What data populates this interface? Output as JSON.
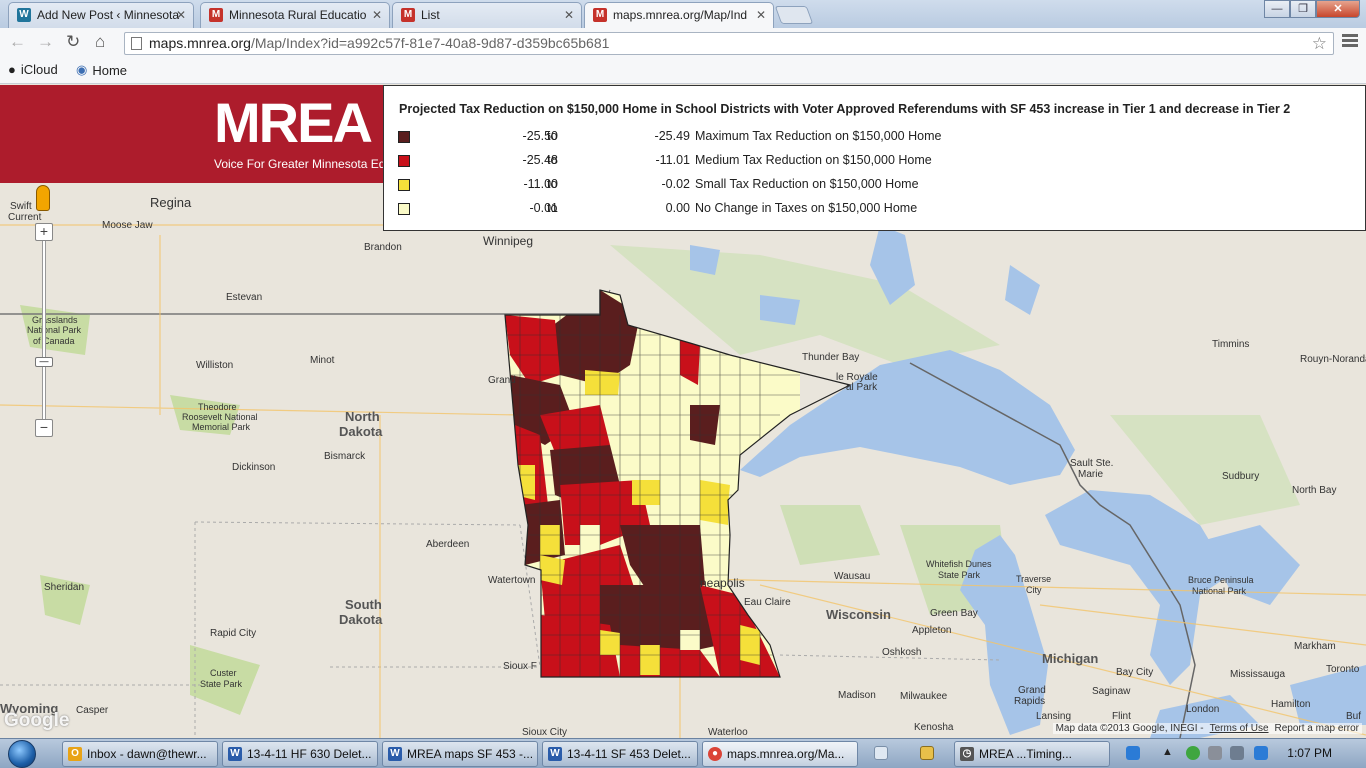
{
  "tabs": [
    {
      "title": "Add New Post ‹ Minnesota",
      "favicon": "wordpress-icon",
      "color": "#21759b",
      "glyph": "W"
    },
    {
      "title": "Minnesota Rural Educatio",
      "favicon": "gmail-icon",
      "color": "#c5322b",
      "glyph": "M"
    },
    {
      "title": "List",
      "favicon": "gmail-icon",
      "color": "#c5322b",
      "glyph": "M"
    },
    {
      "title": "maps.mnrea.org/Map/Ind",
      "favicon": "gmail-icon",
      "color": "#c5322b",
      "glyph": "M"
    }
  ],
  "toolbar": {
    "url_host": "maps.mnrea.org",
    "url_path": "/Map/Index?id=a992c57f-81e7-40a8-9d87-d359bc65b681"
  },
  "bookmarks": [
    {
      "label": "iCloud",
      "icon": "apple-icon"
    },
    {
      "label": "Home",
      "icon": "home-globe-icon"
    }
  ],
  "header": {
    "logo": "MREA",
    "tagline": "Voice For Greater Minnesota Ed"
  },
  "legend": {
    "title": "Projected Tax Reduction on $150,000 Home in School Districts with Voter Approved Referendums with SF 453 increase in Tier 1 and decrease in Tier 2",
    "rows": [
      {
        "color": "#5a1e1e",
        "from": "-25.50",
        "to_word": "to",
        "to": "-25.49",
        "label": "Maximum Tax Reduction on $150,000 Home"
      },
      {
        "color": "#c8101a",
        "from": "-25.48",
        "to_word": "to",
        "to": "-11.01",
        "label": "Medium Tax Reduction on $150,000 Home"
      },
      {
        "color": "#f5e03a",
        "from": "-11.00",
        "to_word": "to",
        "to": "-0.02",
        "label": "Small Tax Reduction on $150,000 Home"
      },
      {
        "color": "#fbfbc8",
        "from": "-0.01",
        "to_word": "to",
        "to": "0.00",
        "label": "No Change in Taxes on $150,000 Home"
      }
    ]
  },
  "map_labels": {
    "regina": "Regina",
    "swift_current_1": "Swift",
    "swift_current_2": "Current",
    "moose_jaw": "Moose Jaw",
    "brandon": "Brandon",
    "winnipeg": "Winnipeg",
    "estevan": "Estevan",
    "grasslands_1": "Grasslands",
    "grasslands_2": "National Park",
    "grasslands_3": "of Canada",
    "williston": "Williston",
    "minot": "Minot",
    "troosevelt_1": "Theodore",
    "troosevelt_2": "Roosevelt National",
    "troosevelt_3": "Memorial Park",
    "north_dakota_1": "North",
    "north_dakota_2": "Dakota",
    "dickinson": "Dickinson",
    "bismarck": "Bismarck",
    "aberdeen": "Aberdeen",
    "watertown": "Watertown",
    "sheridan": "Sheridan",
    "south_dakota_1": "South",
    "south_dakota_2": "Dakota",
    "rapid_city": "Rapid City",
    "custer_1": "Custer",
    "custer_2": "State Park",
    "wyoming": "Wyoming",
    "casper": "Casper",
    "sioux_falls": "Sioux F",
    "sioux_city": "Sioux City",
    "waterloo": "Waterloo",
    "grand": "Grand",
    "thunder_bay": "Thunder Bay",
    "isle_royale_1": "le Royale",
    "isle_royale_2": "al Park",
    "timmins": "Timmins",
    "rouyn": "Rouyn-Noranda",
    "sault_1": "Sault Ste.",
    "sault_2": "Marie",
    "sudbury": "Sudbury",
    "north_bay": "North Bay",
    "minneapolis": "neapolis",
    "eau_claire": "Eau Claire",
    "wausau": "Wausau",
    "whitefish_1": "Whitefish Dunes",
    "whitefish_2": "State Park",
    "traverse_1": "Traverse",
    "traverse_2": "City",
    "bruce_1": "Bruce Peninsula",
    "bruce_2": "National Park",
    "wisconsin": "Wisconsin",
    "green_bay": "Green Bay",
    "appleton": "Appleton",
    "oshkosh": "Oshkosh",
    "michigan": "Michigan",
    "bay_city": "Bay City",
    "saginaw": "Saginaw",
    "markham": "Markham",
    "mississauga": "Mississauga",
    "toronto": "Toronto",
    "hamilton": "Hamilton",
    "madison": "Madison",
    "milwaukee": "Milwaukee",
    "grand_rapids_1": "Grand",
    "grand_rapids_2": "Rapids",
    "lansing": "Lansing",
    "flint": "Flint",
    "london": "London",
    "kenosha": "Kenosha",
    "buffalo": "Buf"
  },
  "map_credit": {
    "data": "Map data ©2013 Google, INEGI -",
    "terms": "Terms of Use",
    "report": "Report a map error",
    "logo": "Google"
  },
  "taskbar": {
    "items": [
      {
        "label": "Inbox - dawn@thewr...",
        "icon": "outlook-icon",
        "color": "#e8a317",
        "glyph": "O"
      },
      {
        "label": "13-4-11 HF 630 Delet...",
        "icon": "word-icon",
        "color": "#2a5caa",
        "glyph": "W"
      },
      {
        "label": "MREA maps SF 453 -...",
        "icon": "word-icon",
        "color": "#2a5caa",
        "glyph": "W"
      },
      {
        "label": "13-4-11 SF 453 Delet...",
        "icon": "word-icon",
        "color": "#2a5caa",
        "glyph": "W"
      },
      {
        "label": "maps.mnrea.org/Ma...",
        "icon": "chrome-icon",
        "color": "#db4437",
        "glyph": "●"
      },
      {
        "label": "MREA ...Timing...",
        "icon": "timer-icon",
        "color": "#555555",
        "glyph": "◷"
      }
    ],
    "clock": "1:07 PM"
  }
}
